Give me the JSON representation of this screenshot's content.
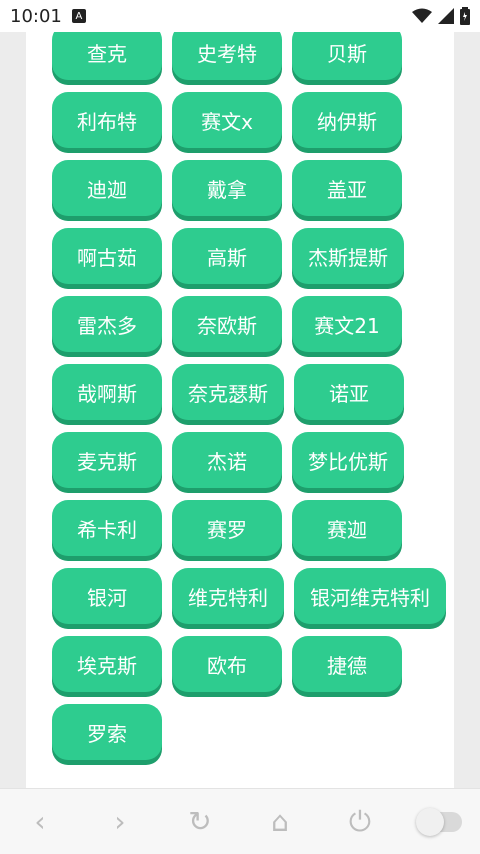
{
  "status_bar": {
    "time": "10:01",
    "badge": "A",
    "icons": [
      "wifi-icon",
      "signal-icon",
      "battery-icon"
    ]
  },
  "buttons": [
    "查克",
    "史考特",
    "贝斯",
    "利布特",
    "赛文x",
    "纳伊斯",
    "迪迦",
    "戴拿",
    "盖亚",
    "啊古茹",
    "高斯",
    "杰斯提斯",
    "雷杰多",
    "奈欧斯",
    "赛文21",
    "哉啊斯",
    "奈克瑟斯",
    "诺亚",
    "麦克斯",
    "杰诺",
    "梦比优斯",
    "希卡利",
    "赛罗",
    "赛迦",
    "银河",
    "维克特利",
    "银河维克特利",
    "埃克斯",
    "欧布",
    "捷德",
    "罗索"
  ],
  "nav": {
    "back": "‹",
    "forward": "›",
    "refresh": "↻",
    "home": "⌂",
    "power": "⏻"
  },
  "colors": {
    "pill_bg": "#2ecc8f",
    "pill_shadow": "#1e9e6c",
    "page_bg": "#ffffff"
  }
}
